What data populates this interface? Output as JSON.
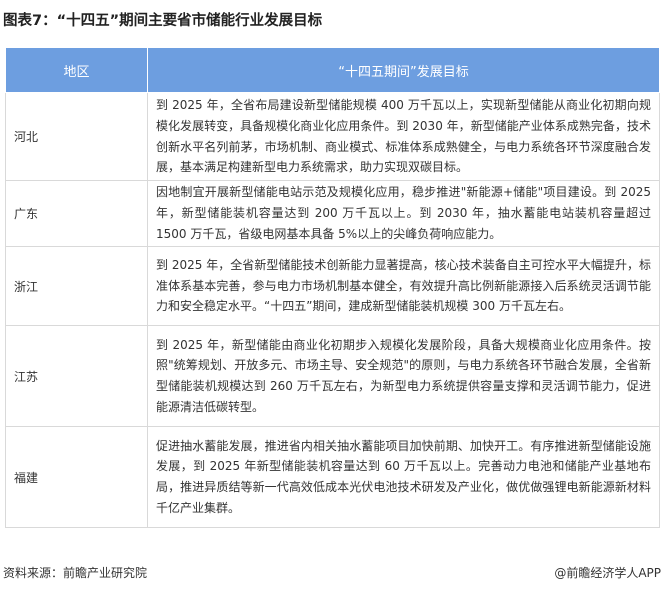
{
  "title": "图表7：“十四五”期间主要省市储能行业发展目标",
  "table": {
    "headers": [
      "地区",
      "“十四五期间”发展目标"
    ],
    "rows": [
      {
        "region": "河北",
        "content": "到 2025 年，全省布局建设新型储能规模 400 万千瓦以上，实现新型储能从商业化初期向规模化发展转变，具备规模化商业化应用条件。到 2030 年，新型储能产业体系成熟完备，技术创新水平名列前茅，市场机制、商业模式、标准体系成熟健全，与电力系统各环节深度融合发展，基本满足构建新型电力系统需求，助力实现双碳目标。"
      },
      {
        "region": "广东",
        "content": "因地制宜开展新型储能电站示范及规模化应用，稳步推进\"新能源+储能\"项目建设。到 2025 年，新型储能装机容量达到 200 万千瓦以上。到 2030 年，抽水蓄能电站装机容量超过 1500 万千瓦，省级电网基本具备 5%以上的尖峰负荷响应能力。"
      },
      {
        "region": "浙江",
        "content": "到 2025 年，全省新型储能技术创新能力显著提高，核心技术装备自主可控水平大幅提升，标准体系基本完善，参与电力市场机制基本健全，有效提升高比例新能源接入后系统灵活调节能力和安全稳定水平。“十四五”期间，建成新型储能装机规模 300 万千瓦左右。"
      },
      {
        "region": "江苏",
        "content": "到 2025 年，新型储能由商业化初期步入规模化发展阶段，具备大规模商业化应用条件。按照\"统筹规划、开放多元、市场主导、安全规范\"的原则，与电力系统各环节融合发展，全省新型储能装机规模达到 260 万千瓦左右，为新型电力系统提供容量支撑和灵活调节能力，促进能源清洁低碳转型。"
      },
      {
        "region": "福建",
        "content": "促进抽水蓄能发展，推进省内相关抽水蓄能项目加快前期、加快开工。有序推进新型储能设施发展，到 2025 年新型储能装机容量达到 60 万千瓦以上。完善动力电池和储能产业基地布局，推进异质结等新一代高效低成本光伏电池技术研发及产业化，做优做强锂电新能源新材料千亿产业集群。"
      }
    ]
  },
  "footer": {
    "source": "资料来源：前瞻产业研究院",
    "brand": "@前瞻经济学人APP"
  }
}
